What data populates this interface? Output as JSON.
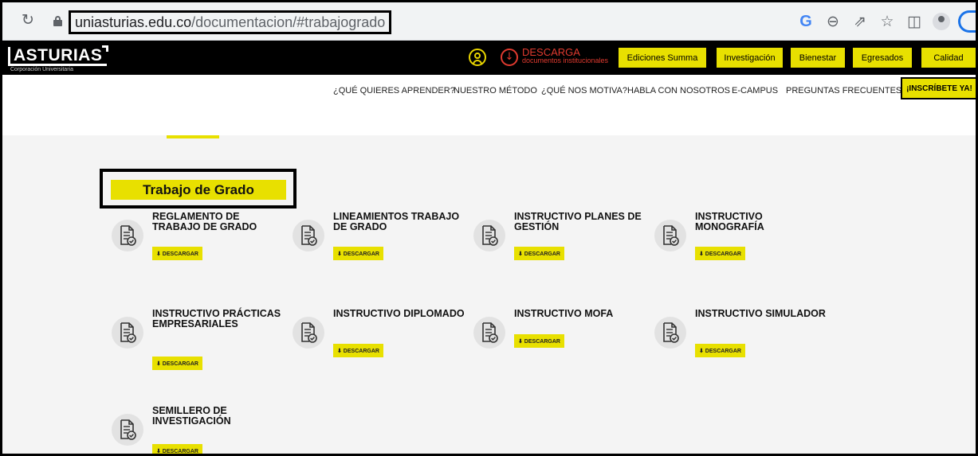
{
  "browser": {
    "url_domain": "uniasturias.edu.co",
    "url_path": "/documentacion/#trabajogrado",
    "icons": [
      "reload-icon",
      "lock-icon",
      "google-icon",
      "zoom-icon",
      "share-icon",
      "star-icon",
      "sidepanel-icon",
      "profile-icon"
    ]
  },
  "site": {
    "logo_text": "ASTURIAS",
    "logo_sub": "Corporación Universitaria",
    "download_title": "DESCARGA",
    "download_sub": "documentos institucionales",
    "top_buttons": [
      "Ediciones Summa",
      "Investigación",
      "Bienestar",
      "Egresados",
      "Calidad"
    ],
    "nav": [
      "¿QUÉ QUIERES APRENDER?",
      "NUESTRO MÉTODO",
      "¿QUÉ NOS MOTIVA?",
      "HABLA CON NOSOTROS",
      "E-CAMPUS",
      "PREGUNTAS FRECUENTES"
    ],
    "cta": "¡INSCRÍBETE YA!",
    "accent": "#e8e000",
    "danger": "#e03a2f"
  },
  "section": {
    "title": "Trabajo de Grado",
    "download_label": "⬇ DESCARGAR",
    "documents": [
      "REGLAMENTO DE TRABAJO DE GRADO",
      "LINEAMIENTOS TRABAJO DE GRADO",
      "INSTRUCTIVO PLANES DE GESTIÓN",
      "INSTRUCTIVO MONOGRAFÍA",
      "INSTRUCTIVO PRÁCTICAS EMPRESARIALES",
      "INSTRUCTIVO DIPLOMADO",
      "INSTRUCTIVO MOFA",
      "INSTRUCTIVO SIMULADOR",
      "SEMILLERO DE INVESTIGACIÓN"
    ]
  }
}
